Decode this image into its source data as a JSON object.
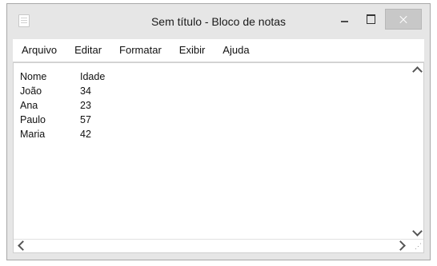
{
  "window": {
    "title": "Sem título - Bloco de notas",
    "close_color": "#c8c8c8"
  },
  "menu": {
    "items": [
      "Arquivo",
      "Editar",
      "Formatar",
      "Exibir",
      "Ajuda"
    ]
  },
  "document": {
    "header": {
      "name": "Nome",
      "age": "Idade"
    },
    "rows": [
      {
        "name": "João",
        "age": "34"
      },
      {
        "name": "Ana",
        "age": "23"
      },
      {
        "name": "Paulo",
        "age": "57"
      },
      {
        "name": "Maria",
        "age": "42"
      }
    ]
  },
  "icons": {
    "app": "notepad-icon",
    "minimize": "minimize-icon",
    "maximize": "maximize-icon",
    "close": "close-icon",
    "scroll_up": "chevron-up-icon",
    "scroll_down": "chevron-down-icon",
    "scroll_left": "chevron-left-icon",
    "scroll_right": "chevron-right-icon",
    "resize_grip": "resize-grip-icon"
  }
}
